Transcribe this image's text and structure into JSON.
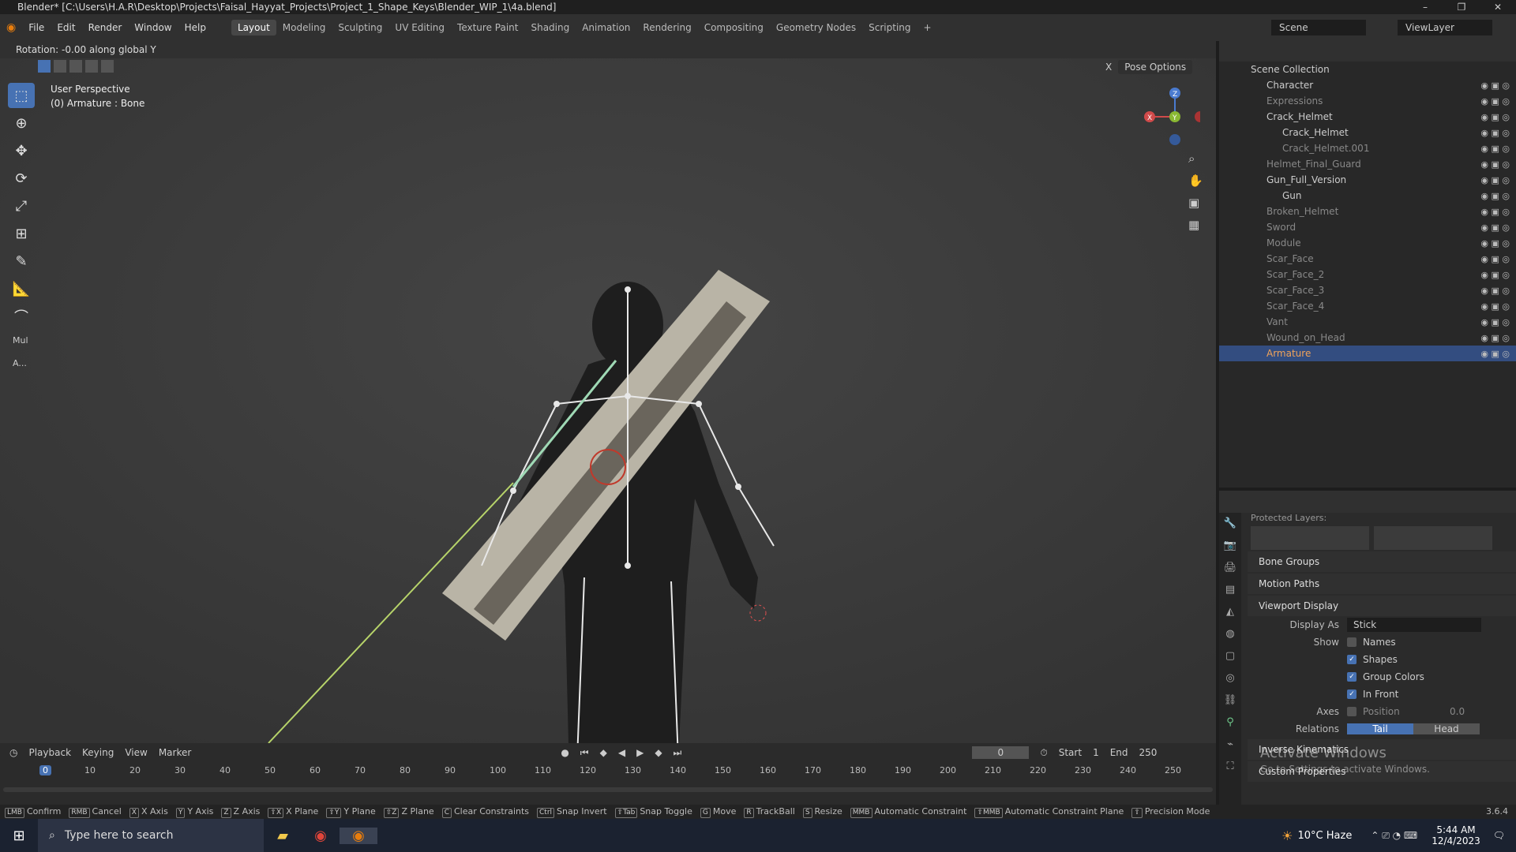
{
  "window": {
    "title": "Blender* [C:\\Users\\H.A.R\\Desktop\\Projects\\Faisal_Hayyat_Projects\\Project_1_Shape_Keys\\Blender_WIP_1\\4a.blend]",
    "min": "–",
    "max": "❐",
    "close": "✕"
  },
  "menu": [
    "File",
    "Edit",
    "Render",
    "Window",
    "Help"
  ],
  "workspaces": [
    "Layout",
    "Modeling",
    "Sculpting",
    "UV Editing",
    "Texture Paint",
    "Shading",
    "Animation",
    "Rendering",
    "Compositing",
    "Geometry Nodes",
    "Scripting",
    "+"
  ],
  "scene": {
    "scene_label": "Scene",
    "view_layer": "ViewLayer"
  },
  "viewport": {
    "header_status": "Rotation: -0.00 along global Y",
    "view_name": "User Perspective",
    "active": "(0) Armature : Bone",
    "pose_options": "Pose Options",
    "x_btn": "X",
    "gizmo": {
      "x": "X",
      "y": "Y",
      "z": "Z"
    },
    "mode_items": [
      "Mul",
      "A..."
    ]
  },
  "outliner": {
    "root": "Scene Collection",
    "items": [
      "Character",
      "Expressions",
      "Crack_Helmet",
      "Crack_Helmet",
      "Crack_Helmet.001",
      "Helmet_Final_Guard",
      "Gun_Full_Version",
      "Gun",
      "Broken_Helmet",
      "Sword",
      "Module",
      "Scar_Face",
      "Scar_Face_2",
      "Scar_Face_3",
      "Scar_Face_4",
      "Vant",
      "Wound_on_Head",
      "Armature"
    ]
  },
  "props": {
    "truncated": "Protected Layers:",
    "bone_groups": "Bone Groups",
    "motion_paths": "Motion Paths",
    "viewport_display": "Viewport Display",
    "display_as_label": "Display As",
    "display_as": "Stick",
    "show": "Show",
    "names": "Names",
    "shapes": "Shapes",
    "group_colors": "Group Colors",
    "in_front": "In Front",
    "axes": "Axes",
    "position": "Position",
    "position_val": "0.0",
    "relations": "Relations",
    "tail": "Tail",
    "head": "Head",
    "ik": "Inverse Kinematics",
    "custom": "Custom Properties",
    "activate1": "Activate Windows",
    "activate2": "Go to Settings to activate Windows."
  },
  "timeline": {
    "playback": "Playback",
    "keying": "Keying",
    "view": "View",
    "marker": "Marker",
    "current": "0",
    "start_label": "Start",
    "start": "1",
    "end_label": "End",
    "end": "250",
    "ticks": [
      "0",
      "10",
      "20",
      "30",
      "40",
      "50",
      "60",
      "70",
      "80",
      "90",
      "100",
      "110",
      "120",
      "130",
      "140",
      "150",
      "160",
      "170",
      "180",
      "190",
      "200",
      "210",
      "220",
      "230",
      "240",
      "250"
    ]
  },
  "status": {
    "items": [
      "Confirm",
      "Cancel",
      "X Axis",
      "Y Axis",
      "Z Axis",
      "X Plane",
      "Y Plane",
      "Z Plane",
      "Clear Constraints",
      "Snap Invert",
      "Snap Toggle",
      "Move",
      "TrackBall",
      "Resize",
      "Automatic Constraint",
      "Automatic Constraint Plane",
      "Precision Mode"
    ],
    "version": "3.6.4"
  },
  "taskbar": {
    "search": "Type here to search",
    "weather": "10°C Haze",
    "time": "5:44 AM",
    "date": "12/4/2023"
  }
}
